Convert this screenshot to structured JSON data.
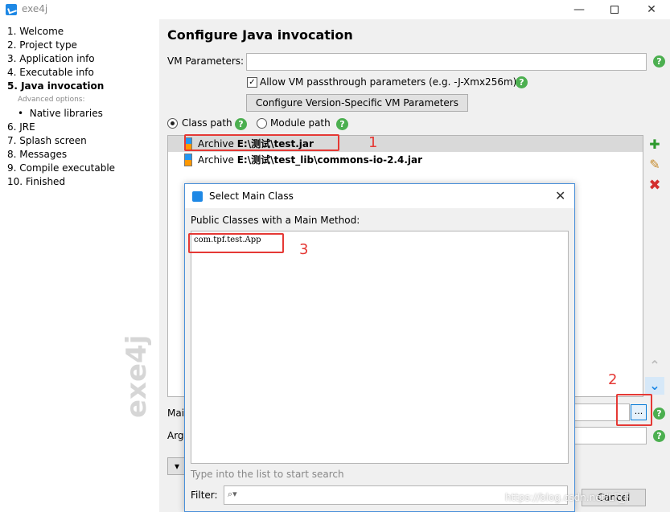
{
  "window": {
    "title": "exe4j",
    "minimize": "—",
    "close": "✕"
  },
  "steps": [
    {
      "label": "1. Welcome"
    },
    {
      "label": "2. Project type"
    },
    {
      "label": "3. Application info"
    },
    {
      "label": "4. Executable info"
    },
    {
      "label": "5. Java invocation"
    },
    {
      "label": "Advanced options:"
    },
    {
      "label": "Native libraries"
    },
    {
      "label": "6. JRE"
    },
    {
      "label": "7. Splash screen"
    },
    {
      "label": "8. Messages"
    },
    {
      "label": "9. Compile executable"
    },
    {
      "label": "10. Finished"
    }
  ],
  "main": {
    "heading": "Configure Java invocation",
    "vm_params_label": "VM Parameters:",
    "vm_params_value": "",
    "allow_passthrough_label": "Allow VM passthrough parameters (e.g. -J-Xmx256m)",
    "allow_passthrough_checked": true,
    "version_specific_button": "Configure Version-Specific VM Parameters",
    "class_path_label": "Class path",
    "module_path_label": "Module path",
    "classpath_entries": [
      {
        "type": "Archive",
        "path": "E:\\测试\\test.jar"
      },
      {
        "type": "Archive",
        "path": "E:\\测试\\test_lib\\commons-io-2.4.jar"
      }
    ],
    "main_class_label_partial": "Mai",
    "args_label_partial": "Arg",
    "browse_button": "...",
    "cancel_button": "Cancel"
  },
  "dialog": {
    "title": "Select Main Class",
    "list_label": "Public Classes with a Main Method:",
    "classes": [
      "com.tpf.test.App"
    ],
    "search_hint": "Type into the list to start search",
    "filter_label": "Filter:",
    "filter_value": ""
  },
  "annotations": {
    "n1": "1",
    "n2": "2",
    "n3": "3"
  },
  "watermark": "exe4j",
  "url_watermark": "https://blog.csdn.net/LF_F",
  "colors": {
    "accent": "#1e88e5",
    "help": "#4caf50",
    "annotation": "#e53935"
  }
}
